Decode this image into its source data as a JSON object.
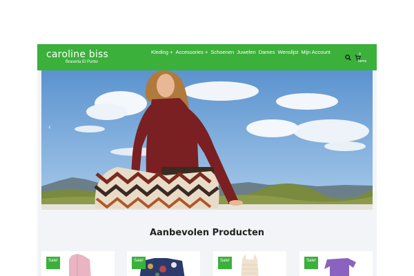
{
  "header": {
    "logo_name": "caroline biss",
    "logo_sub": "Braseria El Punto",
    "nav": [
      "Kleding +",
      "Accessories +",
      "Schoenen",
      "Juwelen",
      "Dames",
      "Wenslijst",
      "Mijn Account"
    ],
    "cart_count": "0",
    "cart_label": "Items"
  },
  "hero": {
    "prev": "‹",
    "next": "›"
  },
  "section": {
    "title": "Aanbevolen Producten"
  },
  "products": [
    {
      "badge": "Sale!",
      "icon": "pink-blouse"
    },
    {
      "badge": "Sale!",
      "icon": "patterned-top"
    },
    {
      "badge": "Sale!",
      "icon": "cream-top"
    },
    {
      "badge": "Sale!",
      "icon": "purple-top"
    }
  ],
  "colors": {
    "accent": "#3bb03b"
  }
}
